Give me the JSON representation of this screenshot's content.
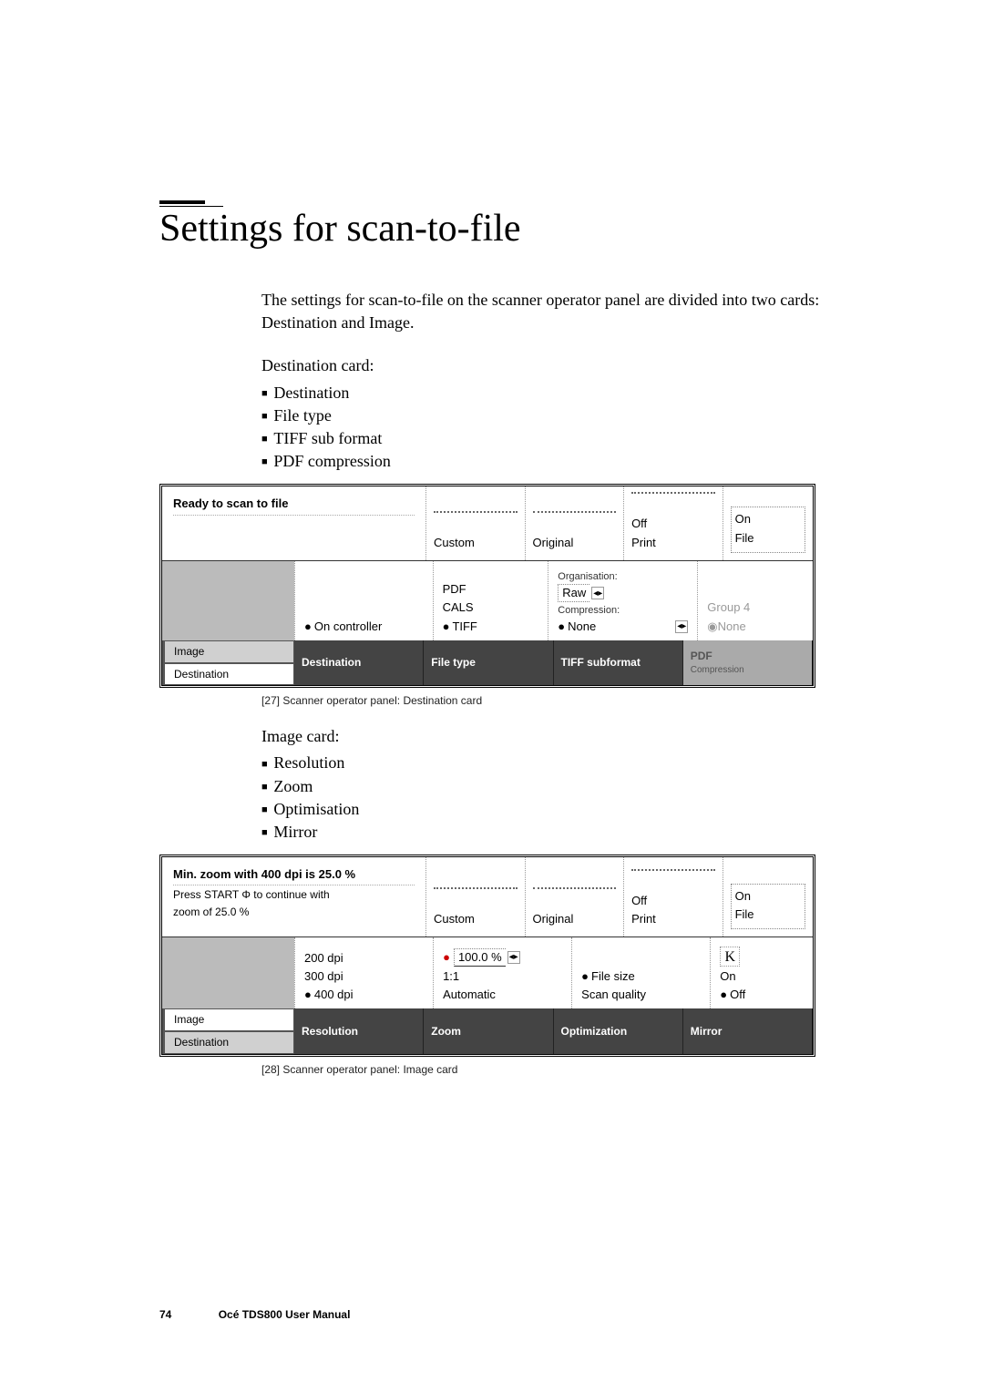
{
  "title": "Settings for scan-to-file",
  "intro": "The settings for scan-to-file on the scanner operator panel are divided into two cards: Destination and Image.",
  "dest_card_heading": "Destination card:",
  "dest_bullets": [
    "Destination",
    "File type",
    "TIFF sub format",
    "PDF compression"
  ],
  "panel1": {
    "status": "Ready to scan to file",
    "tabs_top": {
      "custom": "Custom",
      "original": "Original",
      "off": "Off",
      "print": "Print",
      "on": "On",
      "file": "File"
    },
    "mid": {
      "dest_val": "On controller",
      "filetypes": [
        "PDF",
        "CALS",
        "TIFF"
      ],
      "tiff": {
        "org_label": "Organisation:",
        "org_val": "Raw",
        "comp_label": "Compression:",
        "comp_val": "None"
      },
      "pdf": {
        "group4": "Group 4",
        "none": "None"
      }
    },
    "sidetabs": {
      "image": "Image",
      "destination": "Destination"
    },
    "bottom_tabs": [
      "Destination",
      "File type",
      "TIFF subformat"
    ],
    "bottom_tab_pdf_l1": "PDF",
    "bottom_tab_pdf_l2": "Compression"
  },
  "caption1": "[27] Scanner operator panel: Destination card",
  "image_card_heading": "Image card:",
  "image_bullets": [
    "Resolution",
    "Zoom",
    "Optimisation",
    "Mirror"
  ],
  "panel2": {
    "status_l1": "Min. zoom with 400 dpi is 25.0 %",
    "status_l2": "Press START Φ to continue with",
    "status_l3": "zoom of 25.0 %",
    "tabs_top": {
      "custom": "Custom",
      "original": "Original",
      "off": "Off",
      "print": "Print",
      "on": "On",
      "file": "File"
    },
    "mid": {
      "res": [
        "200 dpi",
        "300 dpi",
        "400 dpi"
      ],
      "zoom": {
        "pct": "100.0 %",
        "oneone": "1:1",
        "auto": "Automatic"
      },
      "opt": {
        "filesize": "File size",
        "scanq": "Scan quality"
      },
      "mirror": {
        "on": "On",
        "off": "Off"
      }
    },
    "sidetabs": {
      "image": "Image",
      "destination": "Destination"
    },
    "bottom_tabs": [
      "Resolution",
      "Zoom",
      "Optimization",
      "Mirror"
    ]
  },
  "caption2": "[28] Scanner operator panel: Image card",
  "footer": {
    "page": "74",
    "manual": "Océ TDS800 User Manual"
  }
}
